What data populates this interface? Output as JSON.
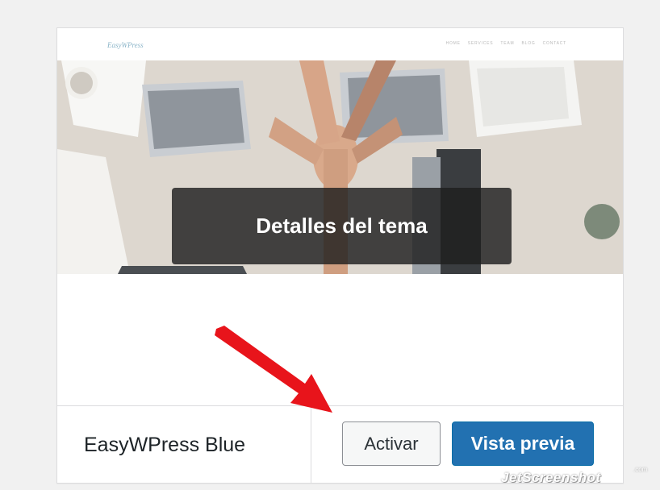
{
  "theme_card": {
    "screenshot": {
      "site_logo": "EasyWPress",
      "nav_items": [
        "HOME",
        "SERVICES",
        "TEAM",
        "BLOG",
        "CONTACT"
      ]
    },
    "overlay_label": "Detalles del tema",
    "theme_name": "EasyWPress Blue",
    "activate_label": "Activar",
    "preview_label": "Vista previa"
  },
  "colors": {
    "primary_button": "#2271b1",
    "arrow": "#e8141b"
  },
  "watermark": {
    "text": "JetScreenshot",
    "suffix": ".com"
  }
}
